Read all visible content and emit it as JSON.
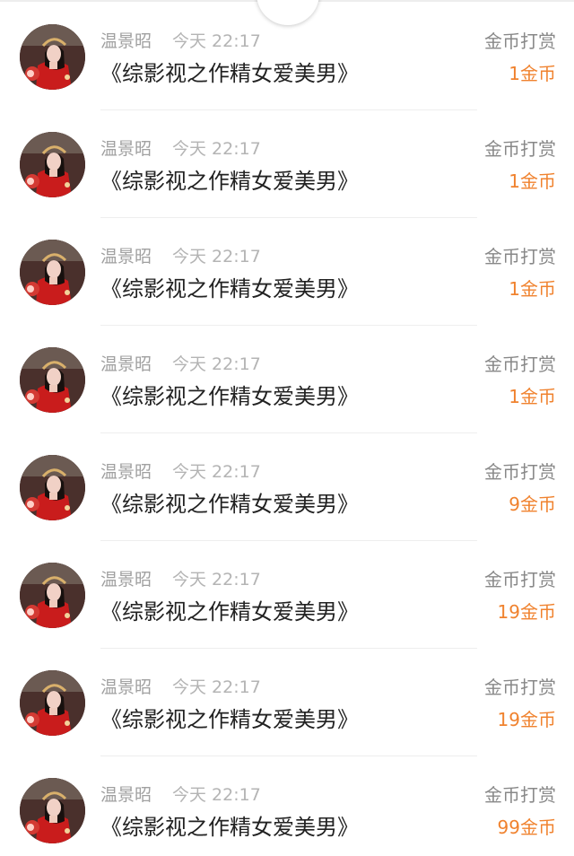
{
  "colors": {
    "background": "#ffffff",
    "name_text": "#a0a0a0",
    "time_text": "#b4b4b4",
    "title_text": "#222222",
    "action_text": "#888888",
    "amount_text": "#f0822e",
    "avatar_red": "#c91c1c"
  },
  "icons": {
    "avatar": "user-avatar-photo",
    "pull_handle": "pull-down-handle"
  },
  "records": [
    {
      "user": "温景昭",
      "time": "今天 22:17",
      "book": "《综影视之作精女爱美男》",
      "action": "金币打赏",
      "amount": "1金币"
    },
    {
      "user": "温景昭",
      "time": "今天 22:17",
      "book": "《综影视之作精女爱美男》",
      "action": "金币打赏",
      "amount": "1金币"
    },
    {
      "user": "温景昭",
      "time": "今天 22:17",
      "book": "《综影视之作精女爱美男》",
      "action": "金币打赏",
      "amount": "1金币"
    },
    {
      "user": "温景昭",
      "time": "今天 22:17",
      "book": "《综影视之作精女爱美男》",
      "action": "金币打赏",
      "amount": "1金币"
    },
    {
      "user": "温景昭",
      "time": "今天 22:17",
      "book": "《综影视之作精女爱美男》",
      "action": "金币打赏",
      "amount": "9金币"
    },
    {
      "user": "温景昭",
      "time": "今天 22:17",
      "book": "《综影视之作精女爱美男》",
      "action": "金币打赏",
      "amount": "19金币"
    },
    {
      "user": "温景昭",
      "time": "今天 22:17",
      "book": "《综影视之作精女爱美男》",
      "action": "金币打赏",
      "amount": "19金币"
    },
    {
      "user": "温景昭",
      "time": "今天 22:17",
      "book": "《综影视之作精女爱美男》",
      "action": "金币打赏",
      "amount": "99金币"
    }
  ]
}
